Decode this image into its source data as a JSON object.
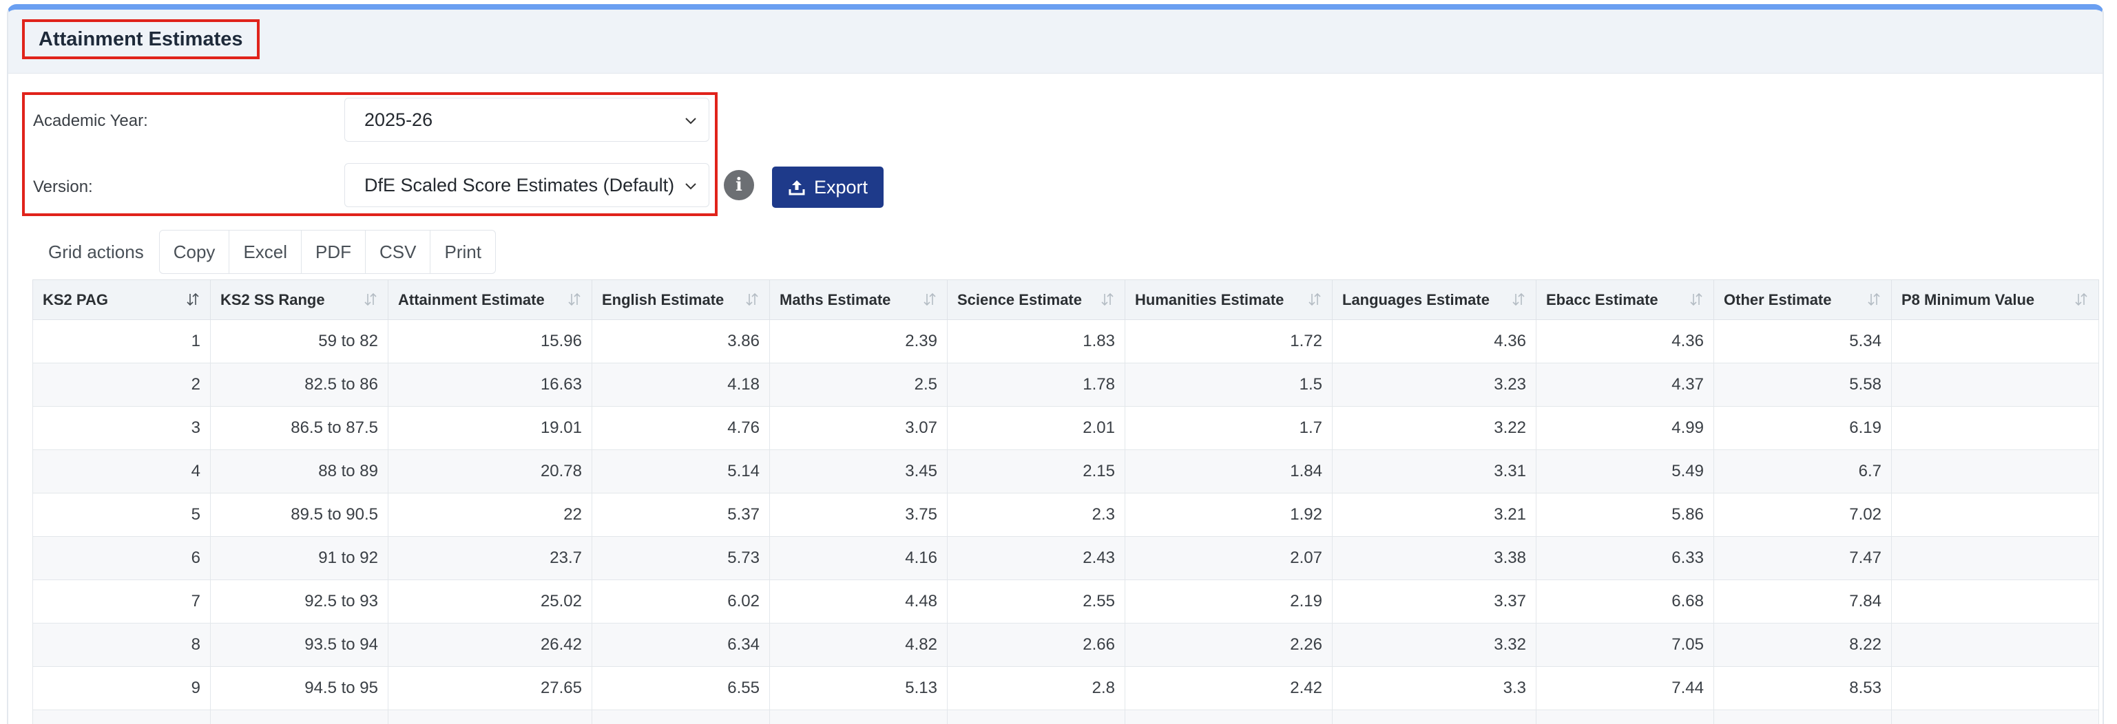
{
  "page": {
    "title": "Attainment Estimates"
  },
  "form": {
    "academic_year": {
      "label": "Academic Year:",
      "value": "2025-26"
    },
    "version": {
      "label": "Version:",
      "value": "DfE Scaled Score Estimates (Default)"
    },
    "info_icon": "info-icon",
    "export_label": "Export"
  },
  "grid_actions": {
    "label": "Grid actions",
    "buttons": [
      "Copy",
      "Excel",
      "PDF",
      "CSV",
      "Print"
    ]
  },
  "table": {
    "headers": [
      "KS2 PAG",
      "KS2 SS Range",
      "Attainment Estimate",
      "English Estimate",
      "Maths Estimate",
      "Science Estimate",
      "Humanities Estimate",
      "Languages Estimate",
      "Ebacc Estimate",
      "Other Estimate",
      "P8 Minimum Value"
    ],
    "rows": [
      [
        "1",
        "59 to 82",
        "15.96",
        "3.86",
        "2.39",
        "1.83",
        "1.72",
        "4.36",
        "4.36",
        "5.34",
        ""
      ],
      [
        "2",
        "82.5 to 86",
        "16.63",
        "4.18",
        "2.5",
        "1.78",
        "1.5",
        "3.23",
        "4.37",
        "5.58",
        ""
      ],
      [
        "3",
        "86.5 to 87.5",
        "19.01",
        "4.76",
        "3.07",
        "2.01",
        "1.7",
        "3.22",
        "4.99",
        "6.19",
        ""
      ],
      [
        "4",
        "88 to 89",
        "20.78",
        "5.14",
        "3.45",
        "2.15",
        "1.84",
        "3.31",
        "5.49",
        "6.7",
        ""
      ],
      [
        "5",
        "89.5 to 90.5",
        "22",
        "5.37",
        "3.75",
        "2.3",
        "1.92",
        "3.21",
        "5.86",
        "7.02",
        ""
      ],
      [
        "6",
        "91 to 92",
        "23.7",
        "5.73",
        "4.16",
        "2.43",
        "2.07",
        "3.38",
        "6.33",
        "7.47",
        ""
      ],
      [
        "7",
        "92.5 to 93",
        "25.02",
        "6.02",
        "4.48",
        "2.55",
        "2.19",
        "3.37",
        "6.68",
        "7.84",
        ""
      ],
      [
        "8",
        "93.5 to 94",
        "26.42",
        "6.34",
        "4.82",
        "2.66",
        "2.26",
        "3.32",
        "7.05",
        "8.22",
        ""
      ],
      [
        "9",
        "94.5 to 95",
        "27.65",
        "6.55",
        "5.13",
        "2.8",
        "2.42",
        "3.3",
        "7.44",
        "8.53",
        ""
      ],
      [
        "",
        "",
        "",
        "",
        "",
        "",
        "",
        "",
        "",
        "",
        ""
      ]
    ]
  },
  "colors": {
    "accent": "#1e3a8a",
    "highlight": "#e0231b",
    "top_border": "#6a9ff1"
  }
}
